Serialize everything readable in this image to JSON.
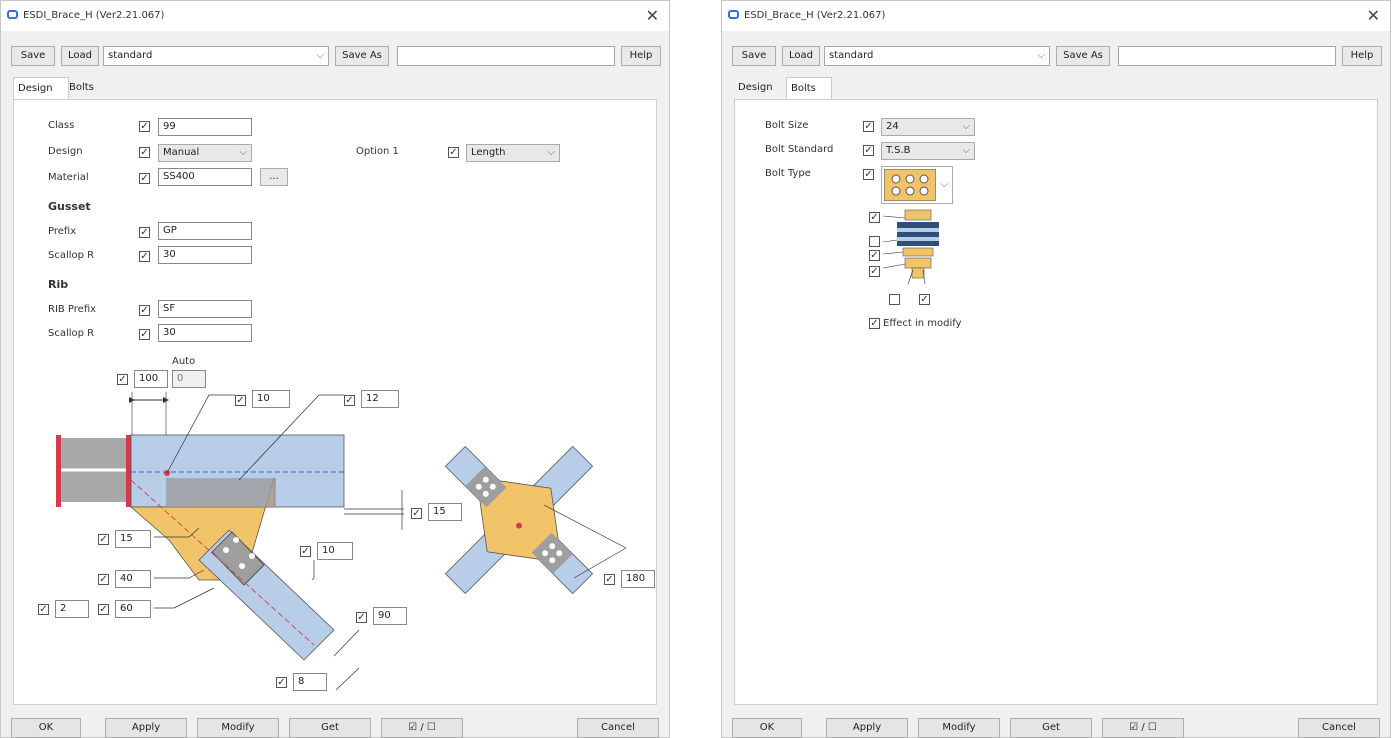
{
  "window": {
    "title": "ESDI_Brace_H (Ver2.21.067)"
  },
  "toolbar": {
    "save": "Save",
    "load": "Load",
    "preset": "standard",
    "save_as": "Save As",
    "help": "Help"
  },
  "tabs": {
    "design": "Design",
    "bolts": "Bolts"
  },
  "design": {
    "class_label": "Class",
    "class_value": "99",
    "design_label": "Design",
    "design_value": "Manual",
    "option1_label": "Option 1",
    "option1_value": "Length",
    "material_label": "Material",
    "material_value": "SS400",
    "material_btn": "...",
    "gusset_header": "Gusset",
    "gusset_prefix_label": "Prefix",
    "gusset_prefix_value": "GP",
    "gusset_scallop_label": "Scallop R",
    "gusset_scallop_value": "30",
    "rib_header": "Rib",
    "rib_prefix_label": "RIB Prefix",
    "rib_prefix_value": "SF",
    "rib_scallop_label": "Scallop R",
    "rib_scallop_value": "30"
  },
  "diagram": {
    "auto_label": "Auto",
    "f_100": "100",
    "f_auto": "0",
    "f_10a": "10",
    "f_12": "12",
    "f_15a": "15",
    "f_15b": "15",
    "f_10b": "10",
    "f_40": "40",
    "f_2": "2",
    "f_60": "60",
    "f_90": "90",
    "f_8": "8",
    "f_180": "180"
  },
  "bolts": {
    "size_label": "Bolt Size",
    "size_value": "24",
    "standard_label": "Bolt Standard",
    "standard_value": "T.S.B",
    "type_label": "Bolt Type",
    "effect_label": "Effect in modify"
  },
  "footer": {
    "ok": "OK",
    "apply": "Apply",
    "modify": "Modify",
    "get": "Get",
    "toggle": "☑ / ☐",
    "cancel": "Cancel"
  },
  "colors": {
    "beam": "#b7cde8",
    "gusset": "#f2c46a",
    "flange": "#d63a4a",
    "plate": "#9e9e9e"
  }
}
